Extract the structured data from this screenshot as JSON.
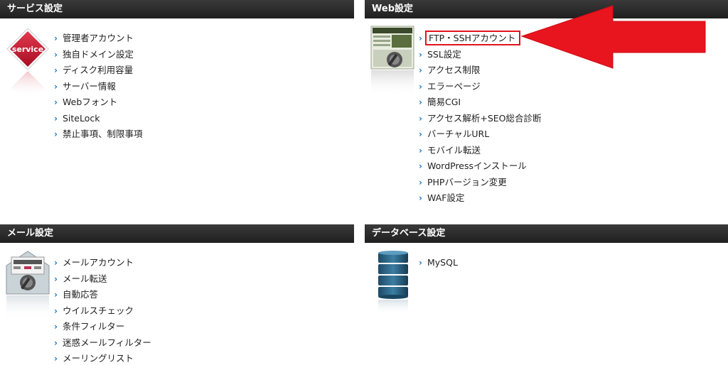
{
  "sections": {
    "service": {
      "title": "サービス設定",
      "icon_text": "service",
      "items": [
        "管理者アカウント",
        "独自ドメイン設定",
        "ディスク利用容量",
        "サーバー情報",
        "Webフォント",
        "SiteLock",
        "禁止事項、制限事項"
      ]
    },
    "web": {
      "title": "Web設定",
      "items": [
        "FTP・SSHアカウント",
        "SSL設定",
        "アクセス制限",
        "エラーページ",
        "簡易CGI",
        "アクセス解析+SEO総合診断",
        "バーチャルURL",
        "モバイル転送",
        "WordPressインストール",
        "PHPバージョン変更",
        "WAF設定"
      ],
      "highlighted_item": "FTP・SSHアカウント"
    },
    "mail": {
      "title": "メール設定",
      "items": [
        "メールアカウント",
        "メール転送",
        "自動応答",
        "ウイルスチェック",
        "条件フィルター",
        "迷惑メールフィルター",
        "メーリングリスト"
      ]
    },
    "database": {
      "title": "データベース設定",
      "items": [
        "MySQL"
      ]
    }
  },
  "colors": {
    "header_bg": "#262626",
    "header_text": "#ffffff",
    "chevron": "#1a76c9",
    "highlight": "#e0141e",
    "arrow": "#e8141e",
    "service_badge": "#c8102e"
  },
  "icons": {
    "service": "service-badge-icon",
    "web": "web-settings-icon",
    "mail": "mail-settings-icon",
    "database": "database-icon",
    "chevron": "chevron-right-icon",
    "annotation": "red-arrow-annotation"
  }
}
